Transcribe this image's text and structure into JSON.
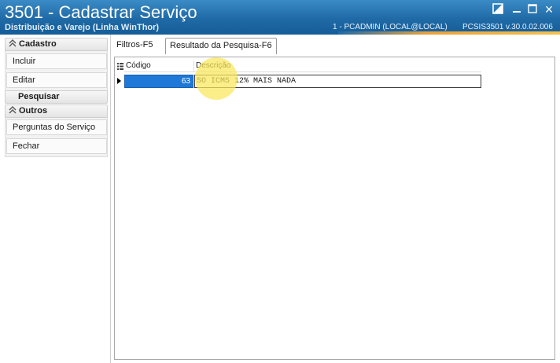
{
  "window": {
    "title": "3501 - Cadastrar Serviço",
    "subtitle": "Distribuição e Varejo (Linha WinThor)",
    "user_info": "1 - PCADMIN (LOCAL@LOCAL)",
    "version": "PCSIS3501  v.30.0.02.006",
    "buttons": {
      "restore": "restore-icon",
      "minimize": "minimize-icon",
      "maximize": "maximize-icon",
      "close": "×"
    }
  },
  "sidebar": {
    "groups": [
      {
        "label": "Cadastro",
        "items": [
          "Incluir",
          "Editar"
        ]
      },
      {
        "label": "Pesquisar",
        "items": []
      },
      {
        "label": "Outros",
        "items": [
          "Perguntas do Serviço",
          "Fechar"
        ]
      }
    ]
  },
  "tabs": [
    {
      "label": "Filtros-F5",
      "active": false
    },
    {
      "label": "Resultado da Pesquisa-F6",
      "active": true
    }
  ],
  "grid": {
    "columns": [
      "Código",
      "Descrição"
    ],
    "rows": [
      {
        "codigo": "63",
        "descricao": "SO ICMS 12% MAIS NADA",
        "selected": true
      }
    ]
  },
  "colors": {
    "titlebar": "#1f6aa6",
    "selection": "#1e78d8",
    "cursor_highlight": "#fae85a"
  }
}
